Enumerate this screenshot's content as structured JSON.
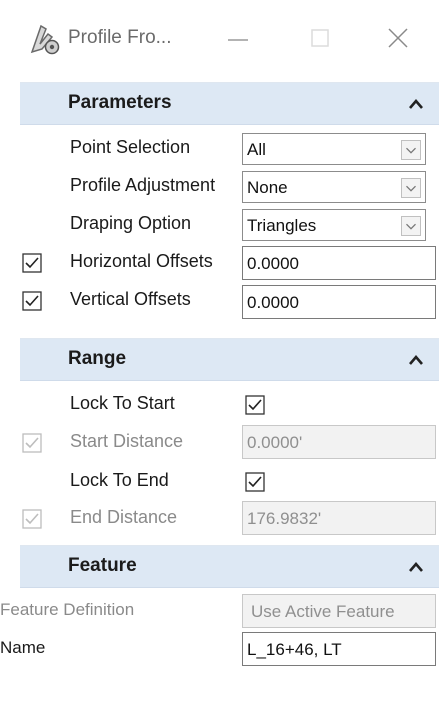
{
  "window": {
    "title": "Profile Fro...",
    "icon": "profile-tool-icon",
    "controls": [
      "minimize-icon",
      "maximize-icon",
      "close-icon"
    ]
  },
  "parameters": {
    "title": "Parameters",
    "point_selection": {
      "label": "Point Selection",
      "value": "All"
    },
    "profile_adjustment": {
      "label": "Profile Adjustment",
      "value": "None"
    },
    "draping_option": {
      "label": "Draping Option",
      "value": "Triangles"
    },
    "horizontal_offsets": {
      "label": "Horizontal Offsets",
      "value": "0.0000",
      "checked": true
    },
    "vertical_offsets": {
      "label": "Vertical Offsets",
      "value": "0.0000",
      "checked": true
    }
  },
  "range": {
    "title": "Range",
    "lock_to_start": {
      "label": "Lock To Start",
      "checked": true
    },
    "start_distance": {
      "label": "Start Distance",
      "value": "0.0000'",
      "checked": true,
      "enabled": false
    },
    "lock_to_end": {
      "label": "Lock To End",
      "checked": true
    },
    "end_distance": {
      "label": "End Distance",
      "value": "176.9832'",
      "checked": true,
      "enabled": false
    }
  },
  "feature": {
    "title": "Feature",
    "feature_definition": {
      "label": "Feature Definition",
      "value": "Use Active Feature",
      "enabled": false
    },
    "name": {
      "label": "Name",
      "value": "L_16+46, LT"
    }
  },
  "colors": {
    "header_bg": "#dde8f4",
    "border": "#8c8c8c",
    "disabled_text": "#8a8a8a"
  }
}
